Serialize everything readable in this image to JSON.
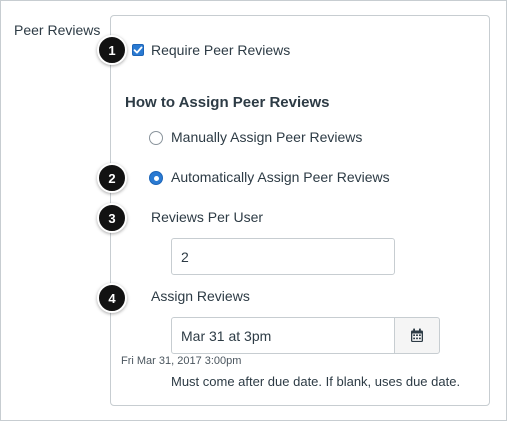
{
  "section": {
    "label": "Peer Reviews"
  },
  "steps": [
    "1",
    "2",
    "3",
    "4"
  ],
  "require": {
    "label": "Require Peer Reviews",
    "checked": true
  },
  "assign": {
    "heading": "How to Assign Peer Reviews",
    "options": [
      {
        "label": "Manually Assign Peer Reviews",
        "selected": false
      },
      {
        "label": "Automatically Assign Peer Reviews",
        "selected": true
      }
    ]
  },
  "reviews_per_user": {
    "label": "Reviews Per User",
    "value": "2"
  },
  "assign_reviews": {
    "label": "Assign Reviews",
    "value": "Mar 31 at 3pm",
    "formatted_date": "Fri Mar 31, 2017 3:00pm",
    "hint": "Must come after due date. If blank, uses due date.",
    "calendar_icon": "calendar-icon"
  },
  "colors": {
    "accent": "#2a7ad2",
    "step_badge": "#121212",
    "border": "#c7cdd1"
  }
}
